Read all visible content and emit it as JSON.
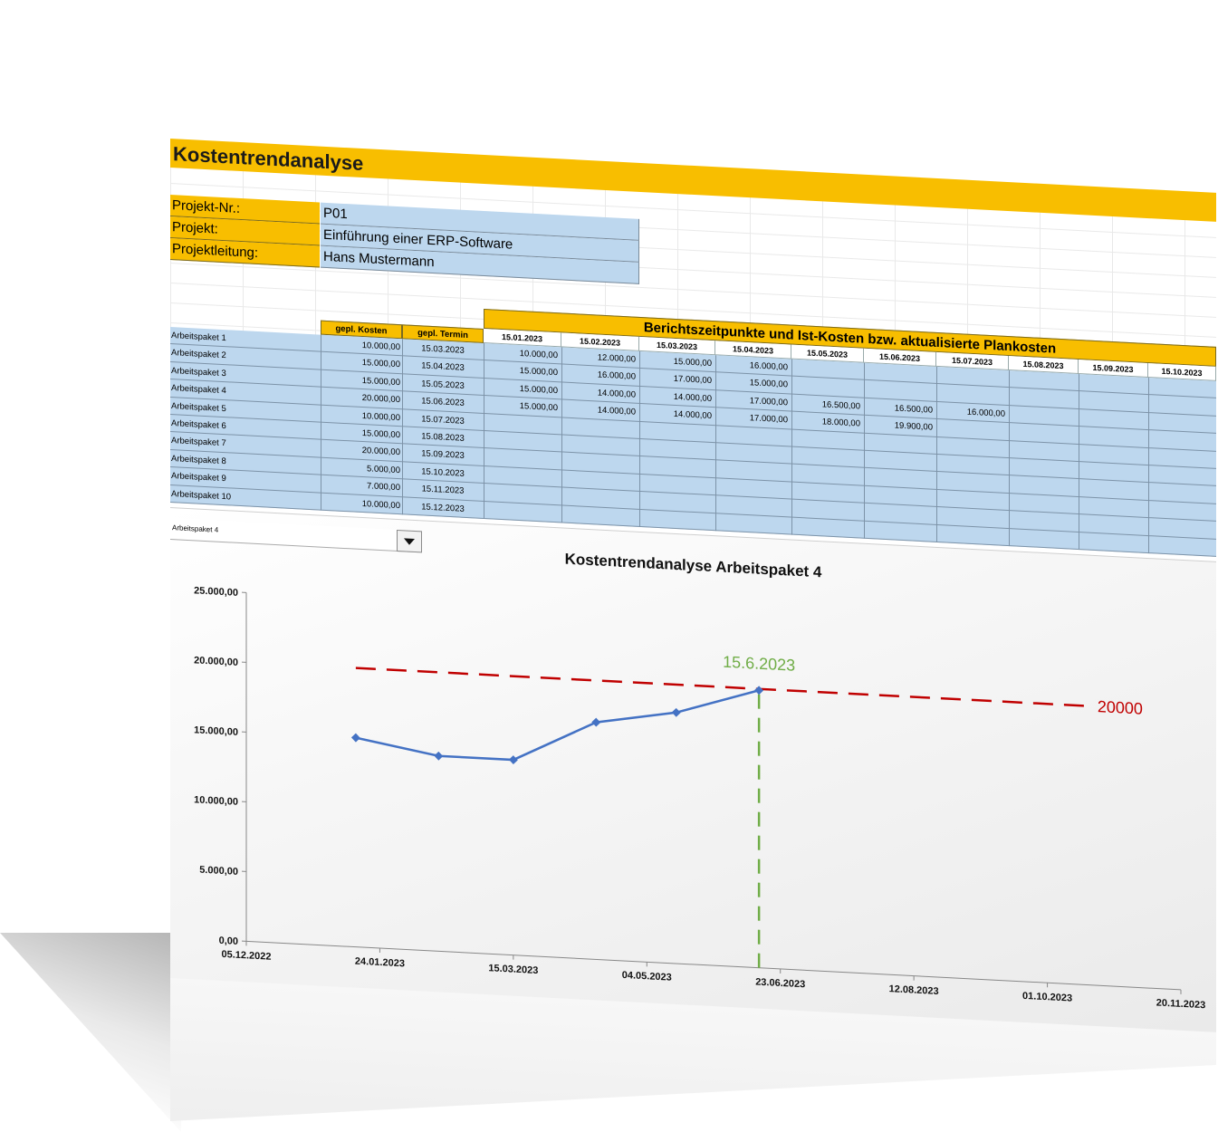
{
  "title": "Kostentrendanalyse",
  "info": [
    {
      "label": "Projekt-Nr.:",
      "value": "P01"
    },
    {
      "label": "Projekt:",
      "value": "Einführung einer ERP-Software"
    },
    {
      "label": "Projektleitung:",
      "value": "Hans Mustermann"
    }
  ],
  "table": {
    "col_costs": "gepl. Kosten",
    "col_date": "gepl. Termin",
    "report_header": "Berichtszeitpunkte und Ist-Kosten bzw. aktualisierte Plankosten",
    "report_dates": [
      "15.01.2023",
      "15.02.2023",
      "15.03.2023",
      "15.04.2023",
      "15.05.2023",
      "15.06.2023",
      "15.07.2023",
      "15.08.2023",
      "15.09.2023",
      "15.10.2023"
    ],
    "rows": [
      {
        "name": "Arbeitspaket 1",
        "costs": "10.000,00",
        "date": "15.03.2023",
        "values": [
          "10.000,00",
          "12.000,00",
          "15.000,00",
          "16.000,00",
          "",
          "",
          "",
          "",
          "",
          ""
        ]
      },
      {
        "name": "Arbeitspaket 2",
        "costs": "15.000,00",
        "date": "15.04.2023",
        "values": [
          "15.000,00",
          "16.000,00",
          "17.000,00",
          "15.000,00",
          "",
          "",
          "",
          "",
          "",
          ""
        ]
      },
      {
        "name": "Arbeitspaket 3",
        "costs": "15.000,00",
        "date": "15.05.2023",
        "values": [
          "15.000,00",
          "14.000,00",
          "14.000,00",
          "17.000,00",
          "16.500,00",
          "16.500,00",
          "16.000,00",
          "",
          "",
          ""
        ]
      },
      {
        "name": "Arbeitspaket 4",
        "costs": "20.000,00",
        "date": "15.06.2023",
        "values": [
          "15.000,00",
          "14.000,00",
          "14.000,00",
          "17.000,00",
          "18.000,00",
          "19.900,00",
          "",
          "",
          "",
          ""
        ]
      },
      {
        "name": "Arbeitspaket 5",
        "costs": "10.000,00",
        "date": "15.07.2023",
        "values": [
          "",
          "",
          "",
          "",
          "",
          "",
          "",
          "",
          "",
          ""
        ]
      },
      {
        "name": "Arbeitspaket 6",
        "costs": "15.000,00",
        "date": "15.08.2023",
        "values": [
          "",
          "",
          "",
          "",
          "",
          "",
          "",
          "",
          "",
          ""
        ]
      },
      {
        "name": "Arbeitspaket 7",
        "costs": "20.000,00",
        "date": "15.09.2023",
        "values": [
          "",
          "",
          "",
          "",
          "",
          "",
          "",
          "",
          "",
          ""
        ]
      },
      {
        "name": "Arbeitspaket 8",
        "costs": "5.000,00",
        "date": "15.10.2023",
        "values": [
          "",
          "",
          "",
          "",
          "",
          "",
          "",
          "",
          "",
          ""
        ]
      },
      {
        "name": "Arbeitspaket 9",
        "costs": "7.000,00",
        "date": "15.11.2023",
        "values": [
          "",
          "",
          "",
          "",
          "",
          "",
          "",
          "",
          "",
          ""
        ]
      },
      {
        "name": "Arbeitspaket 10",
        "costs": "10.000,00",
        "date": "15.12.2023",
        "values": [
          "",
          "",
          "",
          "",
          "",
          "",
          "",
          "",
          "",
          ""
        ]
      }
    ]
  },
  "selector": {
    "selected": "Arbeitspaket 4"
  },
  "colors": {
    "accent": "#f8be00",
    "cell_fill": "#bdd7ee",
    "line": "#4472c4",
    "budget": "#c00000",
    "deadline": "#70ad47"
  },
  "chart_data": {
    "type": "line",
    "title": "Kostentrendanalyse Arbeitspaket 4",
    "x": [
      "15.01.2023",
      "15.02.2023",
      "15.03.2023",
      "15.04.2023",
      "15.05.2023",
      "15.06.2023"
    ],
    "series": [
      {
        "values": [
          15000,
          14000,
          14000,
          17000,
          18000,
          19900
        ]
      }
    ],
    "ylim": [
      0,
      25000
    ],
    "yticks": [
      "0,00",
      "5.000,00",
      "10.000,00",
      "15.000,00",
      "20.000,00",
      "25.000,00"
    ],
    "xlim": [
      "05.12.2022",
      "20.11.2023"
    ],
    "xticks": [
      "05.12.2022",
      "24.01.2023",
      "15.03.2023",
      "04.05.2023",
      "23.06.2023",
      "12.08.2023",
      "01.10.2023",
      "20.11.2023"
    ],
    "annotations": {
      "budget_value": 20000,
      "budget_label": "20000",
      "deadline_date": "15.06.2023",
      "deadline_label": "15.6.2023"
    },
    "grid": false
  }
}
